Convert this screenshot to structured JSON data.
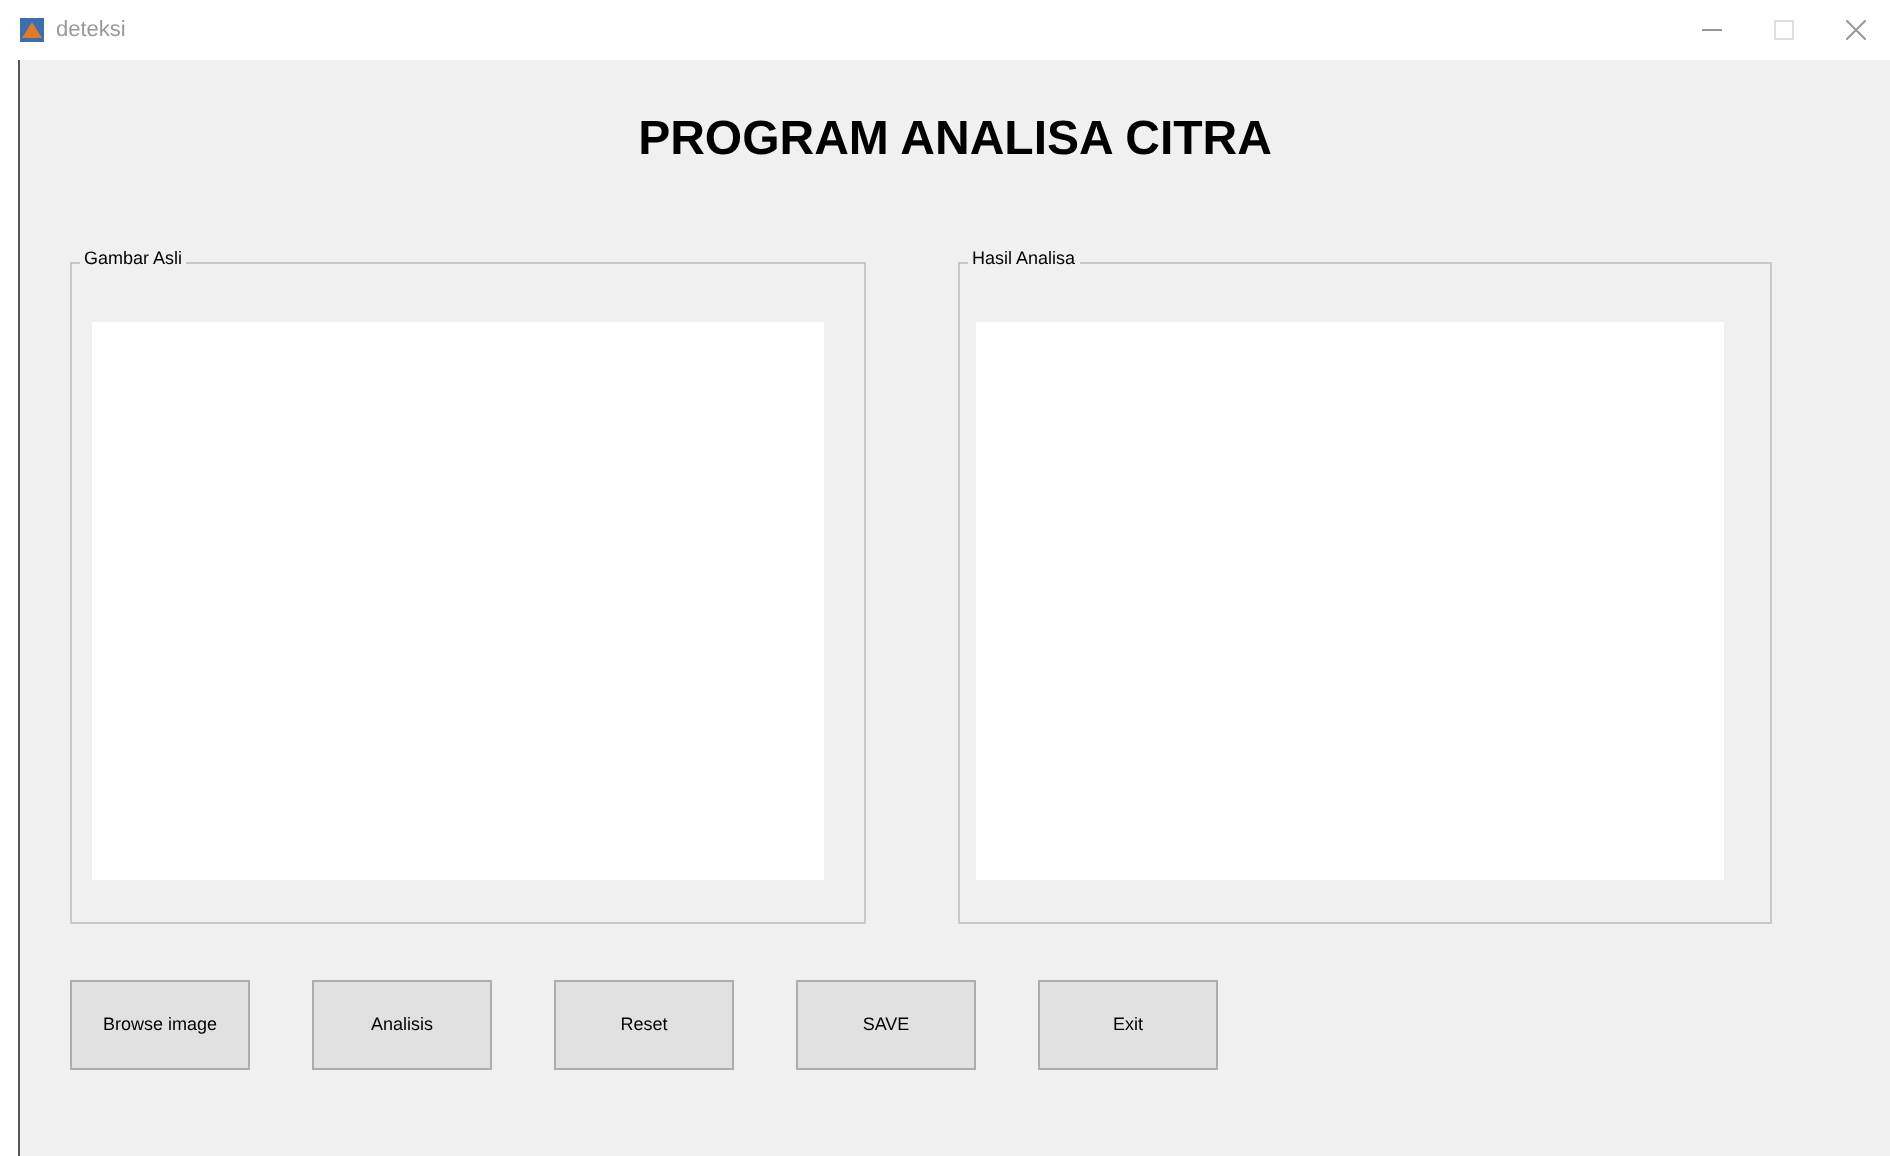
{
  "window": {
    "title": "deteksi"
  },
  "heading": "PROGRAM ANALISA CITRA",
  "panels": [
    {
      "title": "Gambar Asli"
    },
    {
      "title": "Hasil Analisa"
    }
  ],
  "buttons": [
    "Browse image",
    "Analisis",
    "Reset",
    "SAVE",
    "Exit"
  ]
}
